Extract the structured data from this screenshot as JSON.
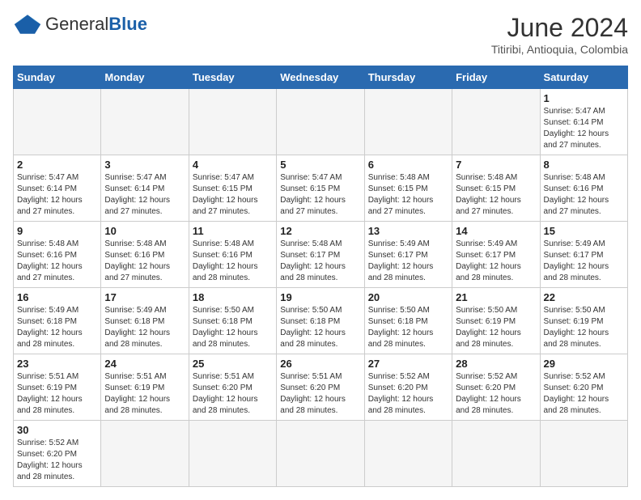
{
  "header": {
    "logo_general": "General",
    "logo_blue": "Blue",
    "month_title": "June 2024",
    "location": "Titiribi, Antioquia, Colombia"
  },
  "weekdays": [
    "Sunday",
    "Monday",
    "Tuesday",
    "Wednesday",
    "Thursday",
    "Friday",
    "Saturday"
  ],
  "weeks": [
    [
      {
        "day": null,
        "info": null
      },
      {
        "day": null,
        "info": null
      },
      {
        "day": null,
        "info": null
      },
      {
        "day": null,
        "info": null
      },
      {
        "day": null,
        "info": null
      },
      {
        "day": null,
        "info": null
      },
      {
        "day": "1",
        "info": "Sunrise: 5:47 AM\nSunset: 6:14 PM\nDaylight: 12 hours and 27 minutes."
      }
    ],
    [
      {
        "day": "2",
        "info": "Sunrise: 5:47 AM\nSunset: 6:14 PM\nDaylight: 12 hours and 27 minutes."
      },
      {
        "day": "3",
        "info": "Sunrise: 5:47 AM\nSunset: 6:14 PM\nDaylight: 12 hours and 27 minutes."
      },
      {
        "day": "4",
        "info": "Sunrise: 5:47 AM\nSunset: 6:15 PM\nDaylight: 12 hours and 27 minutes."
      },
      {
        "day": "5",
        "info": "Sunrise: 5:47 AM\nSunset: 6:15 PM\nDaylight: 12 hours and 27 minutes."
      },
      {
        "day": "6",
        "info": "Sunrise: 5:48 AM\nSunset: 6:15 PM\nDaylight: 12 hours and 27 minutes."
      },
      {
        "day": "7",
        "info": "Sunrise: 5:48 AM\nSunset: 6:15 PM\nDaylight: 12 hours and 27 minutes."
      },
      {
        "day": "8",
        "info": "Sunrise: 5:48 AM\nSunset: 6:16 PM\nDaylight: 12 hours and 27 minutes."
      }
    ],
    [
      {
        "day": "9",
        "info": "Sunrise: 5:48 AM\nSunset: 6:16 PM\nDaylight: 12 hours and 27 minutes."
      },
      {
        "day": "10",
        "info": "Sunrise: 5:48 AM\nSunset: 6:16 PM\nDaylight: 12 hours and 27 minutes."
      },
      {
        "day": "11",
        "info": "Sunrise: 5:48 AM\nSunset: 6:16 PM\nDaylight: 12 hours and 28 minutes."
      },
      {
        "day": "12",
        "info": "Sunrise: 5:48 AM\nSunset: 6:17 PM\nDaylight: 12 hours and 28 minutes."
      },
      {
        "day": "13",
        "info": "Sunrise: 5:49 AM\nSunset: 6:17 PM\nDaylight: 12 hours and 28 minutes."
      },
      {
        "day": "14",
        "info": "Sunrise: 5:49 AM\nSunset: 6:17 PM\nDaylight: 12 hours and 28 minutes."
      },
      {
        "day": "15",
        "info": "Sunrise: 5:49 AM\nSunset: 6:17 PM\nDaylight: 12 hours and 28 minutes."
      }
    ],
    [
      {
        "day": "16",
        "info": "Sunrise: 5:49 AM\nSunset: 6:18 PM\nDaylight: 12 hours and 28 minutes."
      },
      {
        "day": "17",
        "info": "Sunrise: 5:49 AM\nSunset: 6:18 PM\nDaylight: 12 hours and 28 minutes."
      },
      {
        "day": "18",
        "info": "Sunrise: 5:50 AM\nSunset: 6:18 PM\nDaylight: 12 hours and 28 minutes."
      },
      {
        "day": "19",
        "info": "Sunrise: 5:50 AM\nSunset: 6:18 PM\nDaylight: 12 hours and 28 minutes."
      },
      {
        "day": "20",
        "info": "Sunrise: 5:50 AM\nSunset: 6:18 PM\nDaylight: 12 hours and 28 minutes."
      },
      {
        "day": "21",
        "info": "Sunrise: 5:50 AM\nSunset: 6:19 PM\nDaylight: 12 hours and 28 minutes."
      },
      {
        "day": "22",
        "info": "Sunrise: 5:50 AM\nSunset: 6:19 PM\nDaylight: 12 hours and 28 minutes."
      }
    ],
    [
      {
        "day": "23",
        "info": "Sunrise: 5:51 AM\nSunset: 6:19 PM\nDaylight: 12 hours and 28 minutes."
      },
      {
        "day": "24",
        "info": "Sunrise: 5:51 AM\nSunset: 6:19 PM\nDaylight: 12 hours and 28 minutes."
      },
      {
        "day": "25",
        "info": "Sunrise: 5:51 AM\nSunset: 6:20 PM\nDaylight: 12 hours and 28 minutes."
      },
      {
        "day": "26",
        "info": "Sunrise: 5:51 AM\nSunset: 6:20 PM\nDaylight: 12 hours and 28 minutes."
      },
      {
        "day": "27",
        "info": "Sunrise: 5:52 AM\nSunset: 6:20 PM\nDaylight: 12 hours and 28 minutes."
      },
      {
        "day": "28",
        "info": "Sunrise: 5:52 AM\nSunset: 6:20 PM\nDaylight: 12 hours and 28 minutes."
      },
      {
        "day": "29",
        "info": "Sunrise: 5:52 AM\nSunset: 6:20 PM\nDaylight: 12 hours and 28 minutes."
      }
    ],
    [
      {
        "day": "30",
        "info": "Sunrise: 5:52 AM\nSunset: 6:20 PM\nDaylight: 12 hours and 28 minutes."
      },
      {
        "day": null,
        "info": null
      },
      {
        "day": null,
        "info": null
      },
      {
        "day": null,
        "info": null
      },
      {
        "day": null,
        "info": null
      },
      {
        "day": null,
        "info": null
      },
      {
        "day": null,
        "info": null
      }
    ]
  ]
}
